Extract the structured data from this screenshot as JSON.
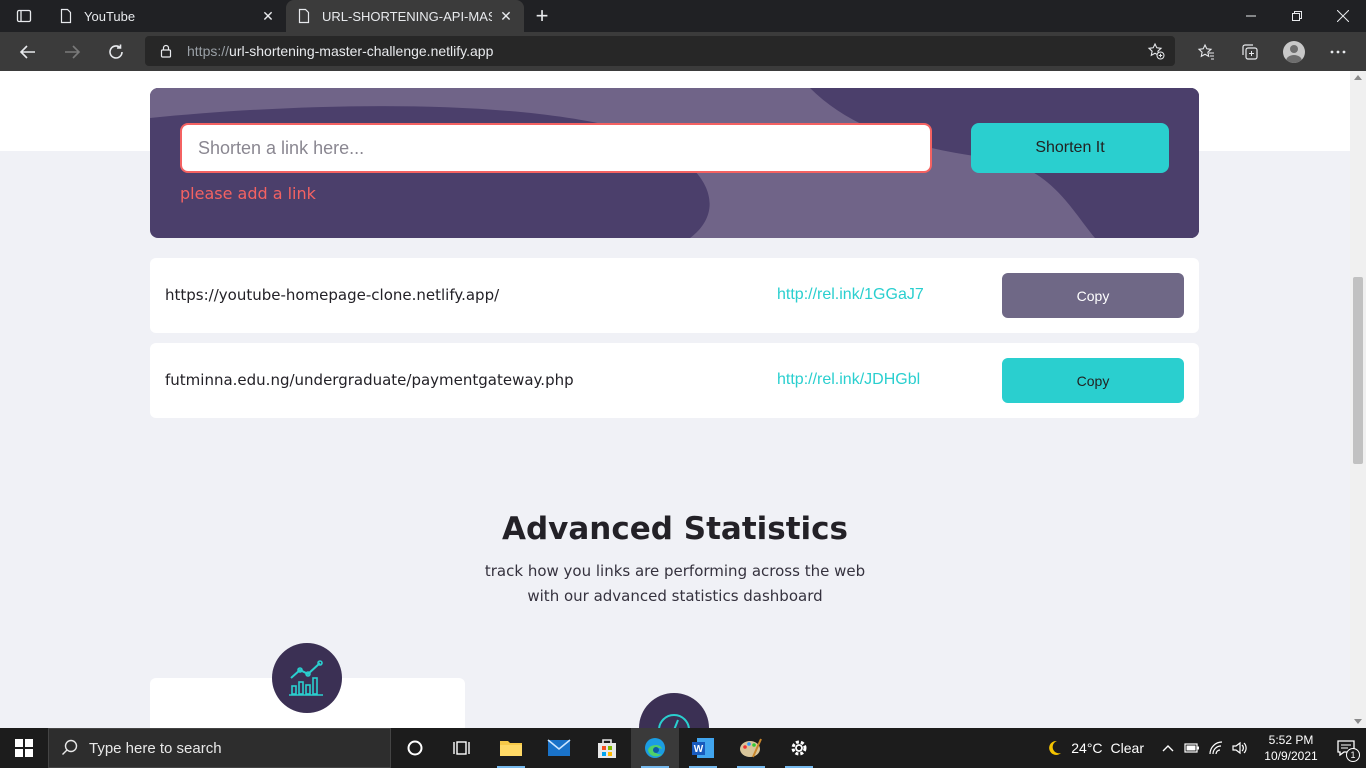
{
  "browser": {
    "tabs": [
      {
        "title": "YouTube",
        "active": false
      },
      {
        "title": "URL-SHORTENING-API-MASTER",
        "active": true
      }
    ],
    "address": {
      "scheme": "https://",
      "host": "url-shortening-master-challenge.netlify.app"
    }
  },
  "shortener": {
    "input_placeholder": "Shorten a link here...",
    "input_value": "",
    "error_text": "please add a link",
    "button_label": "Shorten It",
    "colors": {
      "box_bg": "#4b3f6b",
      "accent": "#2acfcf",
      "error": "#f46262"
    }
  },
  "results": [
    {
      "original": "https://youtube-homepage-clone.netlify.app/",
      "short": "http://rel.ink/1GGaJ7",
      "copy_label": "Copy",
      "copied": true
    },
    {
      "original": "futminna.edu.ng/undergraduate/paymentgateway.php",
      "short": "http://rel.ink/JDHGbl",
      "copy_label": "Copy",
      "copied": false
    }
  ],
  "stats": {
    "title": "Advanced Statistics",
    "subtitle": "track how you links are performing across the web with our advanced statistics dashboard"
  },
  "taskbar": {
    "search_placeholder": "Type here to search",
    "apps": [
      "task-view",
      "widgets",
      "file-explorer",
      "mail",
      "store",
      "edge",
      "word",
      "paint",
      "settings"
    ],
    "weather": {
      "temp": "24°C",
      "condition": "Clear"
    },
    "time": "5:52 PM",
    "date": "10/9/2021",
    "notification_count": "1"
  }
}
